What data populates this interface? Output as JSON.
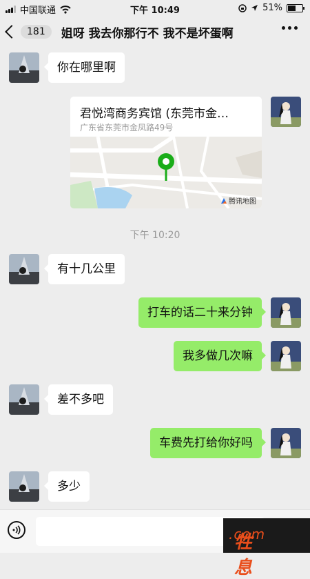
{
  "status_bar": {
    "carrier": "中国联通",
    "time": "下午 10:49",
    "battery": "51%"
  },
  "header": {
    "back_count": "181",
    "title": "姐呀 我去你那行不 我不是坏蛋啊"
  },
  "messages": {
    "m1": "你在哪里啊",
    "location": {
      "title": "君悦湾商务宾馆 (东莞市金…",
      "address": "广东省东莞市金凤路49号",
      "map_brand": "腾讯地图"
    },
    "timestamp": "下午 10:20",
    "m2": "有十几公里",
    "m3": "打车的话二十来分钟",
    "m4": "我多做几次嘛",
    "m5": "差不多吧",
    "m6": "车费先打给你好吗",
    "m7": "多少"
  },
  "watermark": {
    "main": "牲息",
    "suffix": ".com"
  },
  "colors": {
    "self_bubble": "#95ec69",
    "other_bubble": "#ffffff",
    "background": "#ededed",
    "map_pin": "#1aad19"
  }
}
